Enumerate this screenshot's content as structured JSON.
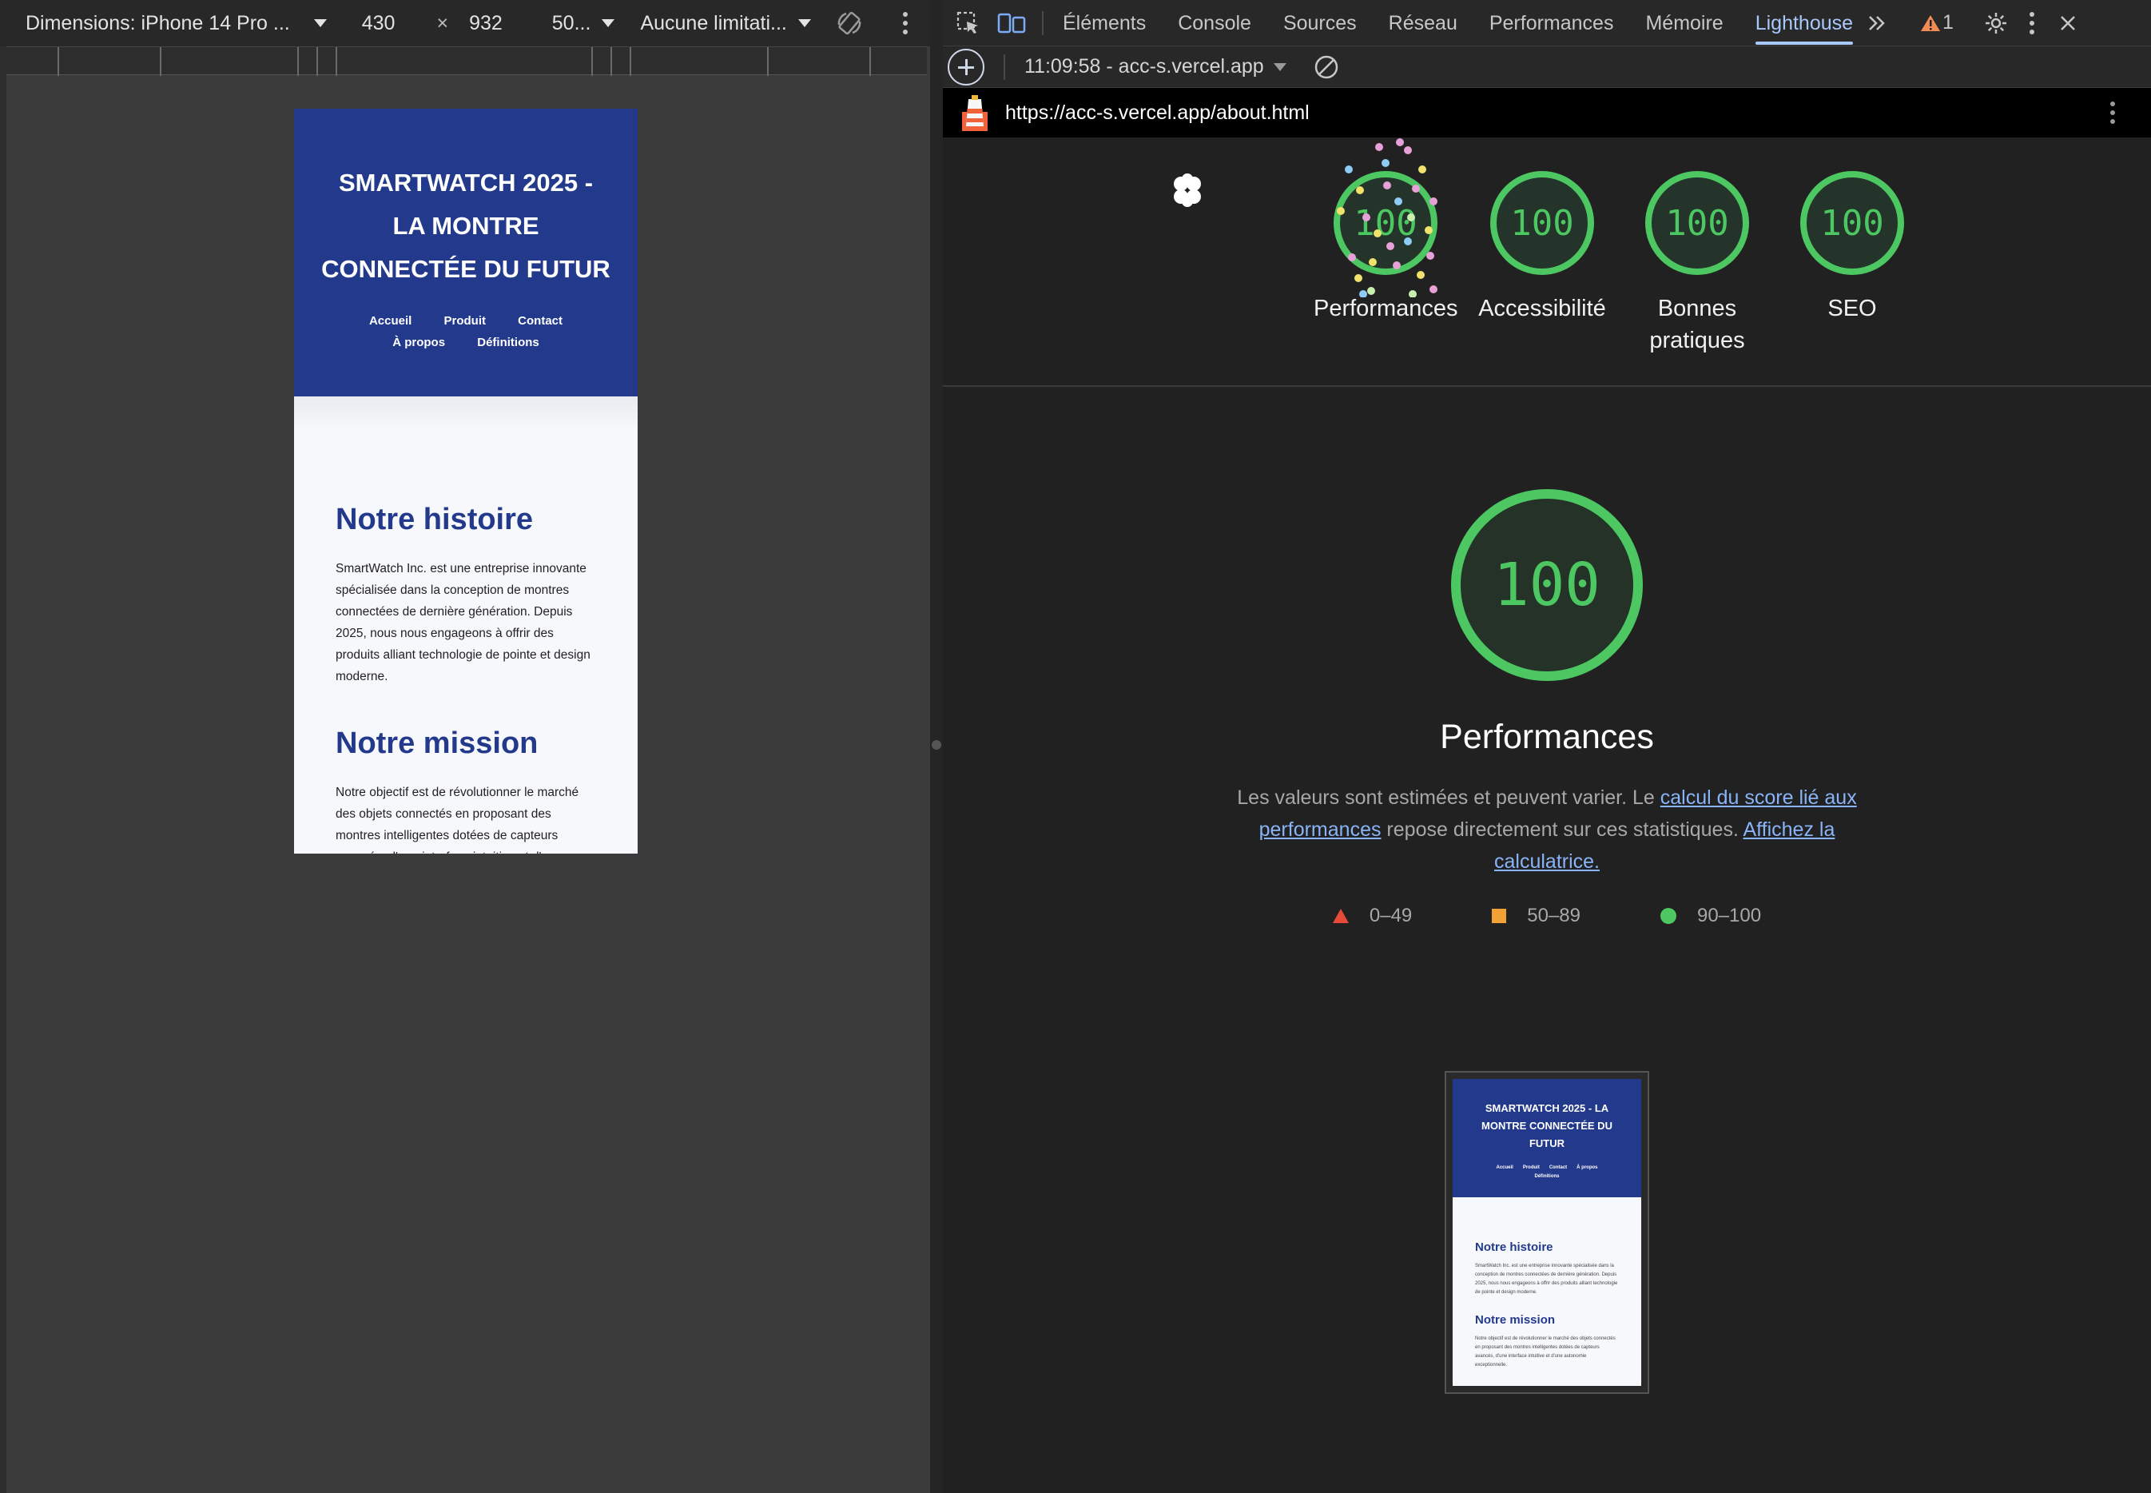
{
  "device_toolbar": {
    "dimensions_label": "Dimensions: iPhone 14 Pro ...",
    "width": "430",
    "times": "×",
    "height": "932",
    "zoom": "50...",
    "throttling": "Aucune limitati..."
  },
  "devtools": {
    "tabs": [
      "Éléments",
      "Console",
      "Sources",
      "Réseau",
      "Performances",
      "Mémoire",
      "Lighthouse"
    ],
    "active_tab": "Lighthouse",
    "warning_count": "1",
    "report_selector": "11:09:58 - acc-s.vercel.app",
    "url": "https://acc-s.vercel.app/about.html"
  },
  "scores": [
    {
      "label": "Performances",
      "value": "100"
    },
    {
      "label": "Accessibilité",
      "value": "100"
    },
    {
      "label": "Bonnes pratiques",
      "value": "100"
    },
    {
      "label": "SEO",
      "value": "100"
    }
  ],
  "main_score": {
    "value": "100",
    "title": "Performances",
    "desc_1": "Les valeurs sont estimées et peuvent varier. Le ",
    "link_1": "calcul du score lié aux performances",
    "desc_2": " repose directement sur ces statistiques. ",
    "link_2": "Affichez la calculatrice."
  },
  "legend": {
    "fail": "0–49",
    "average": "50–89",
    "pass": "90–100"
  },
  "site": {
    "title": "SMARTWATCH 2025 - LA MONTRE CONNECTÉE DU FUTUR",
    "nav": [
      "Accueil",
      "Produit",
      "Contact",
      "À propos",
      "Définitions"
    ],
    "h2_history": "Notre histoire",
    "p_history": "SmartWatch Inc. est une entreprise innovante spécialisée dans la conception de montres connectées de dernière génération. Depuis 2025, nous nous engageons à offrir des produits alliant technologie de pointe et design moderne.",
    "h2_mission": "Notre mission",
    "p_mission": "Notre objectif est de révolutionner le marché des objets connectés en proposant des montres intelligentes dotées de capteurs avancés, d'une interface intuitive et d'une autonomie exceptionnelle."
  },
  "colors": {
    "site_primary": "#233a8c",
    "score_pass": "#4cc762",
    "score_average": "#f2a134",
    "score_fail": "#e84a3a",
    "devtools_accent": "#a8c7fa"
  }
}
